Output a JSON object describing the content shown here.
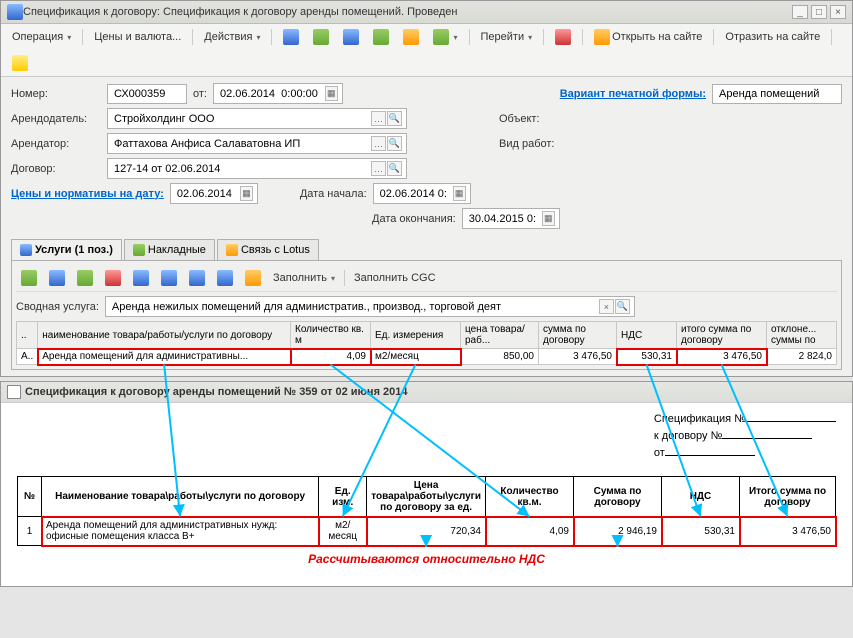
{
  "title": "Спецификация к договору: Спецификация к договору аренды помещений. Проведен",
  "toolbar": {
    "operation": "Операция",
    "prices": "Цены и валюта...",
    "actions": "Действия",
    "goto": "Перейти",
    "open_site": "Открыть на сайте",
    "reflect_site": "Отразить на сайте"
  },
  "form": {
    "number_lbl": "Номер:",
    "number": "СХ000359",
    "from_lbl": "от:",
    "from": "02.06.2014  0:00:00",
    "printform_lbl": "Вариант печатной формы:",
    "printform": "Аренда помещений",
    "lessor_lbl": "Арендодатель:",
    "lessor": "Стройхолдинг ООО",
    "object_lbl": "Объект:",
    "lessee_lbl": "Арендатор:",
    "lessee": "Фаттахова Анфиса Салаватовна ИП",
    "worktype_lbl": "Вид работ:",
    "contract_lbl": "Договор:",
    "contract": "127-14 от 02.06.2014",
    "norm_date_lbl": "Цены и нормативы на дату:",
    "norm_date": "02.06.2014",
    "start_lbl": "Дата начала:",
    "start": "02.06.2014 0:",
    "end_lbl": "Дата окончания:",
    "end": "30.04.2015 0:"
  },
  "tabs": {
    "services": "Услуги (1 поз.)",
    "waybills": "Накладные",
    "lotus": "Связь с Lotus"
  },
  "tabtool": {
    "fill": "Заполнить",
    "fillcgc": "Заполнить CGC"
  },
  "summary_lbl": "Сводная услуга:",
  "summary": "Аренда нежилых помещений для административ., производ., торговой деят",
  "grid_head": {
    "name": "наименование товара/работы/услуги по договору",
    "qty": "Количество кв. м",
    "unit": "Ед. измерения",
    "price": "цена товара/раб...",
    "sum": "сумма по договору",
    "vat": "НДС",
    "total": "итого сумма по договору",
    "dev": "отклоне... суммы по"
  },
  "grid_row": {
    "idx": "А..",
    "name": "Аренда помещений для административны...",
    "qty": "4,09",
    "unit": "м2/месяц",
    "price": "850,00",
    "sum": "3 476,50",
    "vat": "530,31",
    "total": "3 476,50",
    "dev": "2 824,0"
  },
  "lower_title": "Спецификация к договору аренды помещений № 359 от 02 июня 2014",
  "pf_head": {
    "spec": "Спецификация №",
    "cont": "к договору №",
    "from": "от"
  },
  "pt_head": {
    "n": "№",
    "name": "Наименование товара\\работы\\услуги по договору",
    "unit": "Ед. изм.",
    "price": "Цена товара\\работы\\услуги по договору за ед.",
    "qty": "Количество кв.м.",
    "sum": "Сумма по договору",
    "vat": "НДС",
    "total": "Итого сумма по договору"
  },
  "pt_row": {
    "n": "1",
    "name": "Аренда помещений для административных нужд: офисные помещения класса B+",
    "unit": "м2/месяц",
    "price": "720,34",
    "qty": "4,09",
    "sum": "2 946,19",
    "vat": "530,31",
    "total": "3 476,50"
  },
  "calc_note": "Рассчитываются относительно НДС"
}
